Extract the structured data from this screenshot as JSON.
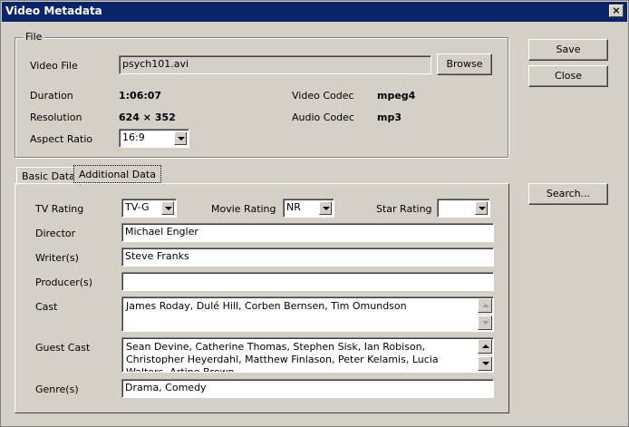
{
  "window": {
    "title": "Video Metadata"
  },
  "file_group": {
    "legend": "File",
    "video_file_label": "Video File",
    "video_file_value": "psych101.avi",
    "browse_label": "Browse",
    "duration_label": "Duration",
    "duration_value": "1:06:07",
    "resolution_label": "Resolution",
    "resolution_value": "624 × 352",
    "aspect_label": "Aspect Ratio",
    "aspect_value": "16:9",
    "video_codec_label": "Video Codec",
    "video_codec_value": "mpeg4",
    "audio_codec_label": "Audio Codec",
    "audio_codec_value": "mp3"
  },
  "buttons": {
    "save": "Save",
    "close": "Close",
    "search": "Search..."
  },
  "tabs": [
    {
      "label": "Basic Data",
      "active": false
    },
    {
      "label": "Additional Data",
      "active": true
    }
  ],
  "additional": {
    "tv_rating_label": "TV Rating",
    "tv_rating_value": "TV-G",
    "movie_rating_label": "Movie Rating",
    "movie_rating_value": "NR",
    "star_rating_label": "Star Rating",
    "star_rating_value": "",
    "director_label": "Director",
    "director_value": "Michael Engler",
    "writers_label": "Writer(s)",
    "writers_value": "Steve Franks",
    "producers_label": "Producer(s)",
    "producers_value": "",
    "cast_label": "Cast",
    "cast_value": "James Roday, Dulé Hill, Corben Bernsen, Tim Omundson",
    "guest_cast_label": "Guest Cast",
    "guest_cast_value": "Sean Devine, Catherine Thomas, Stephen Sisk, Ian Robison, Christopher Heyerdahl, Matthew Finlason, Peter Kelamis, Lucia Walters, Artine Brown,",
    "genres_label": "Genre(s)",
    "genres_value": "Drama, Comedy"
  }
}
